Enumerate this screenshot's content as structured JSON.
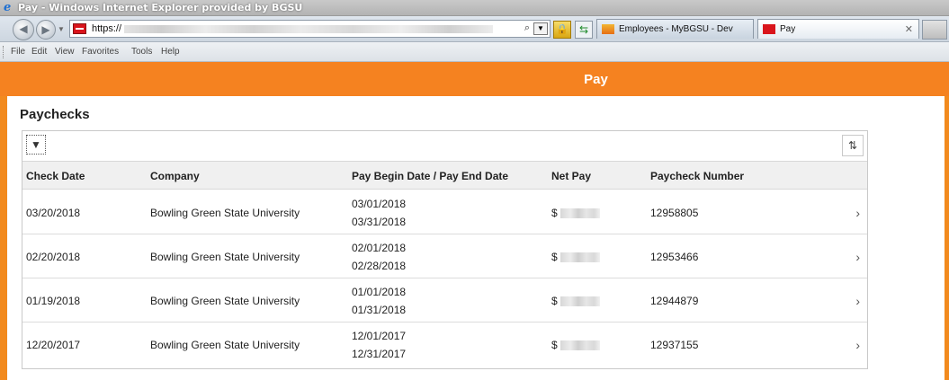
{
  "browser": {
    "window_title": "Pay - Windows Internet Explorer provided by BGSU",
    "address_prefix": "https://",
    "tabs": [
      {
        "label": "Employees - MyBGSU - Dev"
      },
      {
        "label": "Pay"
      }
    ],
    "menu": [
      "File",
      "Edit",
      "View",
      "Favorites",
      "Tools",
      "Help"
    ]
  },
  "page": {
    "header_title": "Pay",
    "section_title": "Paychecks",
    "columns": {
      "check_date": "Check Date",
      "company": "Company",
      "period": "Pay Begin Date / Pay End Date",
      "net_pay": "Net Pay",
      "paycheck_number": "Paycheck Number"
    },
    "rows": [
      {
        "check_date": "03/20/2018",
        "company": "Bowling Green State University",
        "begin": "03/01/2018",
        "end": "03/31/2018",
        "net_prefix": "$",
        "number": "12958805"
      },
      {
        "check_date": "02/20/2018",
        "company": "Bowling Green State University",
        "begin": "02/01/2018",
        "end": "02/28/2018",
        "net_prefix": "$",
        "number": "12953466"
      },
      {
        "check_date": "01/19/2018",
        "company": "Bowling Green State University",
        "begin": "01/01/2018",
        "end": "01/31/2018",
        "net_prefix": "$",
        "number": "12944879"
      },
      {
        "check_date": "12/20/2017",
        "company": "Bowling Green State University",
        "begin": "12/01/2017",
        "end": "12/31/2017",
        "net_prefix": "$",
        "number": "12937155"
      }
    ]
  },
  "colors": {
    "accent_orange": "#f58220",
    "header_bg": "#f0f0f0"
  },
  "icons": {
    "filter": "filter-icon",
    "sort": "sort-icon",
    "row_nav": "chevron-right-icon"
  }
}
